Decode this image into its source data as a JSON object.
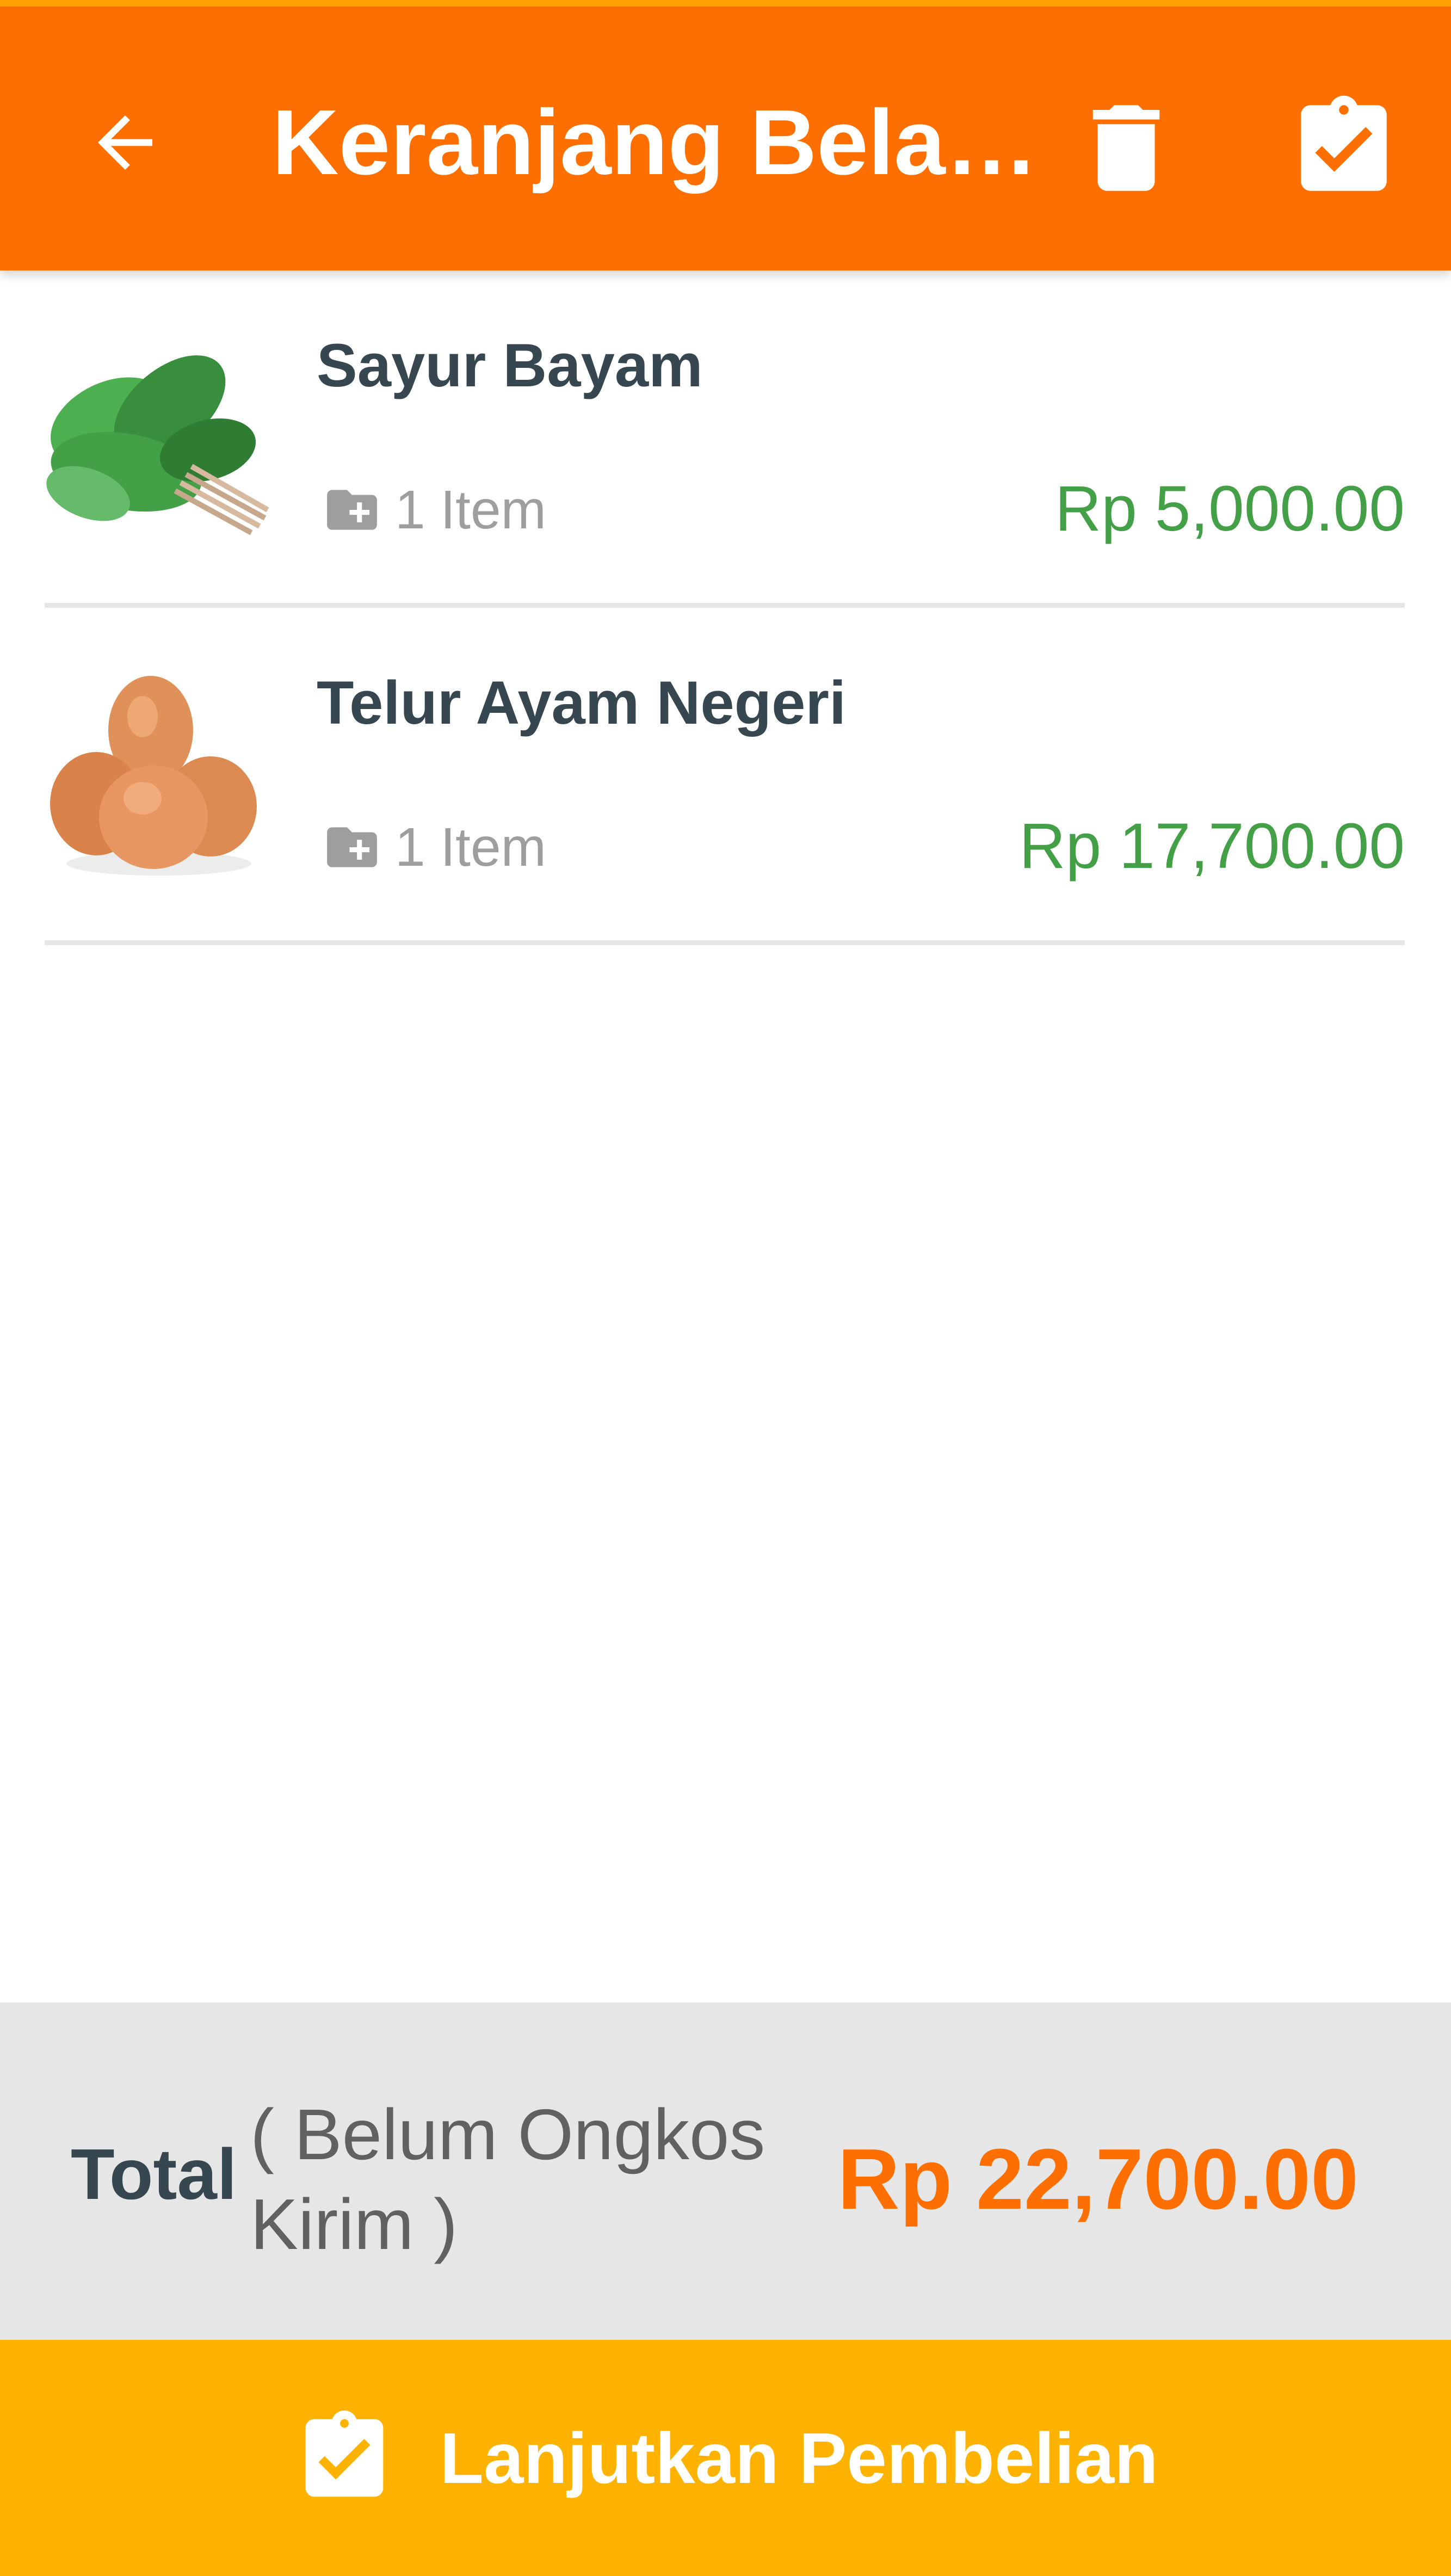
{
  "header": {
    "title": "Keranjang Bela…",
    "back_icon": "arrow-left-icon",
    "delete_icon": "trash-icon",
    "checkout_icon": "clipboard-check-icon"
  },
  "cart": {
    "items": [
      {
        "name": "Sayur Bayam",
        "quantity_label": "1 Item",
        "price": "Rp 5,000.00",
        "image": "spinach-image"
      },
      {
        "name": "Telur Ayam Negeri",
        "quantity_label": "1 Item",
        "price": "Rp 17,700.00",
        "image": "eggs-image"
      }
    ]
  },
  "summary": {
    "total_label": "Total",
    "total_note": "( Belum Ongkos Kirim )",
    "total_amount": "Rp 22,700.00"
  },
  "cta": {
    "label": "Lanjutkan Pembelian",
    "icon": "clipboard-check-icon"
  },
  "colors": {
    "primary": "#ff6f00",
    "accent": "#ffb300",
    "price": "#43a047",
    "text_dark": "#37474f"
  }
}
